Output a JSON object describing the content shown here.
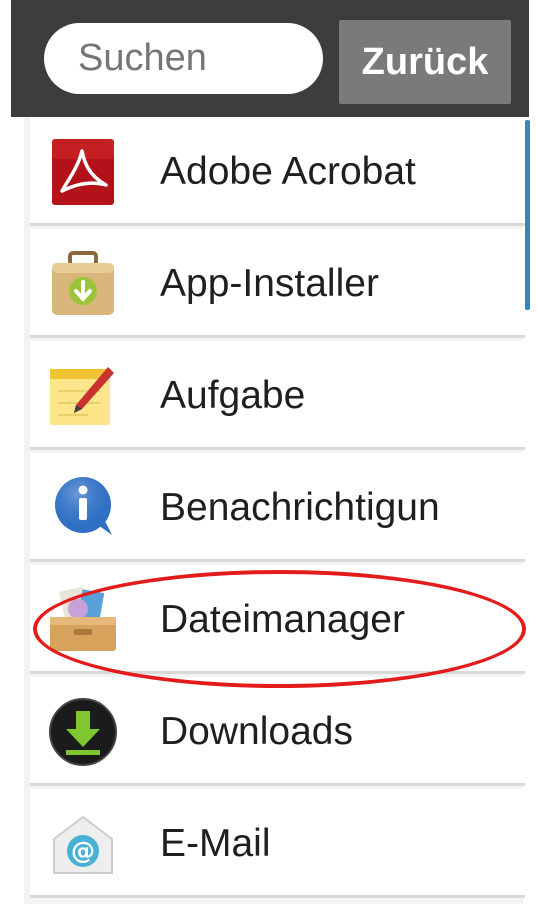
{
  "header": {
    "search_placeholder": "Suchen",
    "back_label": "Zurück"
  },
  "apps": [
    {
      "label": "Adobe Acrobat",
      "icon": "adobe-acrobat-icon"
    },
    {
      "label": "App-Installer",
      "icon": "app-installer-icon"
    },
    {
      "label": "Aufgabe",
      "icon": "task-notepad-icon"
    },
    {
      "label": "Benachrichtigun",
      "icon": "info-bubble-icon"
    },
    {
      "label": "Dateimanager",
      "icon": "file-manager-box-icon"
    },
    {
      "label": "Downloads",
      "icon": "download-arrow-icon"
    },
    {
      "label": "E-Mail",
      "icon": "email-envelope-icon"
    }
  ],
  "colors": {
    "header_bg": "#3d3d3b",
    "button_bg": "#7a7a7a",
    "scrollbar": "#2e8ab8",
    "highlight": "#e31b1b"
  }
}
